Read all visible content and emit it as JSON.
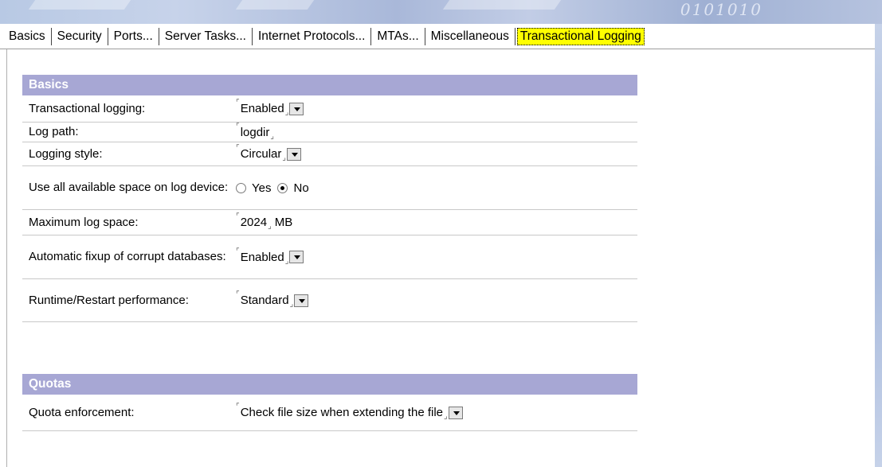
{
  "banner": {
    "decoration": "0101010"
  },
  "tabs": [
    {
      "label": "Basics"
    },
    {
      "label": "Security"
    },
    {
      "label": "Ports..."
    },
    {
      "label": "Server Tasks..."
    },
    {
      "label": "Internet Protocols..."
    },
    {
      "label": "MTAs..."
    },
    {
      "label": "Miscellaneous"
    },
    {
      "label": "Transactional Logging",
      "active": true
    }
  ],
  "sections": {
    "basics": {
      "title": "Basics",
      "rows": {
        "transactional_logging": {
          "label": "Transactional logging:",
          "value": "Enabled"
        },
        "log_path": {
          "label": "Log path:",
          "value": "logdir"
        },
        "logging_style": {
          "label": "Logging style:",
          "value": "Circular"
        },
        "use_all_space": {
          "label": "Use all available space on log device:",
          "options": [
            "Yes",
            "No"
          ],
          "selected": "No"
        },
        "max_log_space": {
          "label": "Maximum log space:",
          "value": "2024",
          "unit": "MB"
        },
        "auto_fixup": {
          "label": "Automatic fixup of corrupt databases:",
          "value": "Enabled"
        },
        "runtime_restart": {
          "label": "Runtime/Restart performance:",
          "value": "Standard"
        }
      }
    },
    "quotas": {
      "title": "Quotas",
      "rows": {
        "quota_enforcement": {
          "label": "Quota enforcement:",
          "value": "Check file size when extending the file"
        }
      }
    }
  },
  "colors": {
    "section_header": "#a7a7d4",
    "active_tab": "#ffff00"
  }
}
